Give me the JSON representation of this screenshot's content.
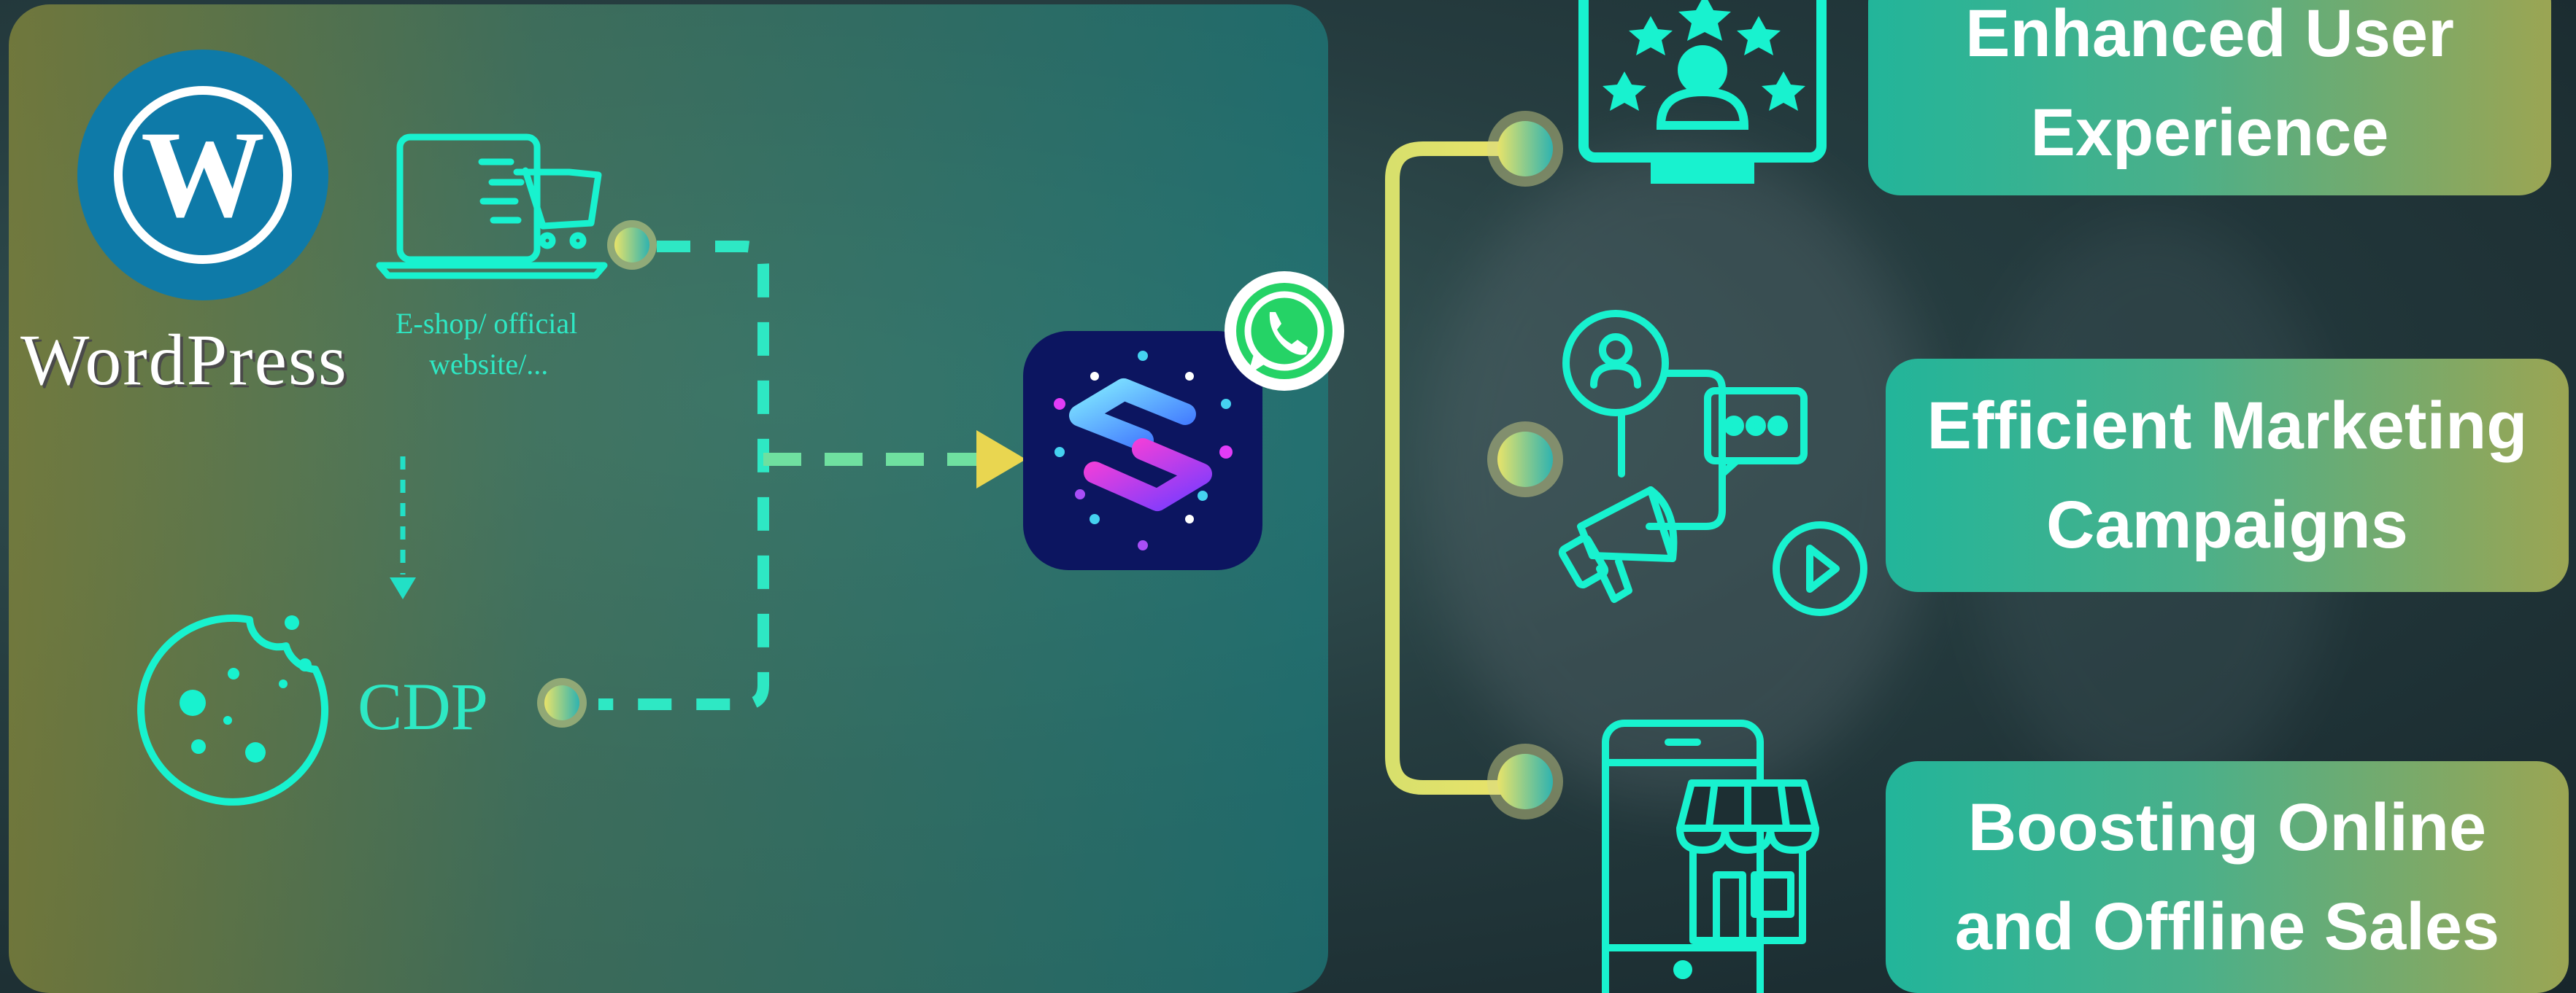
{
  "left_panel": {
    "wordpress_label": "WordPress",
    "eshop_label_line1": "E-shop/ official",
    "eshop_label_line2": "website/...",
    "cdp_label": "CDP"
  },
  "outcomes": [
    {
      "line1": "Enhanced User",
      "line2": "Experience"
    },
    {
      "line1": "Efficient Marketing",
      "line2": "Campaigns"
    },
    {
      "line1": "Boosting Online",
      "line2": "and Offline Sales"
    }
  ],
  "colors": {
    "accent_teal": "#18f2cf",
    "accent_yellow": "#e6e06a",
    "wordpress_blue": "#0e7aa8",
    "hub_navy": "#0c1560"
  },
  "icons": [
    "wordpress-logo-icon",
    "laptop-cart-icon",
    "cookie-icon",
    "whatsapp-icon",
    "hub-app-icon",
    "monitor-user-stars-icon",
    "marketing-megaphone-icon",
    "mobile-store-icon"
  ]
}
